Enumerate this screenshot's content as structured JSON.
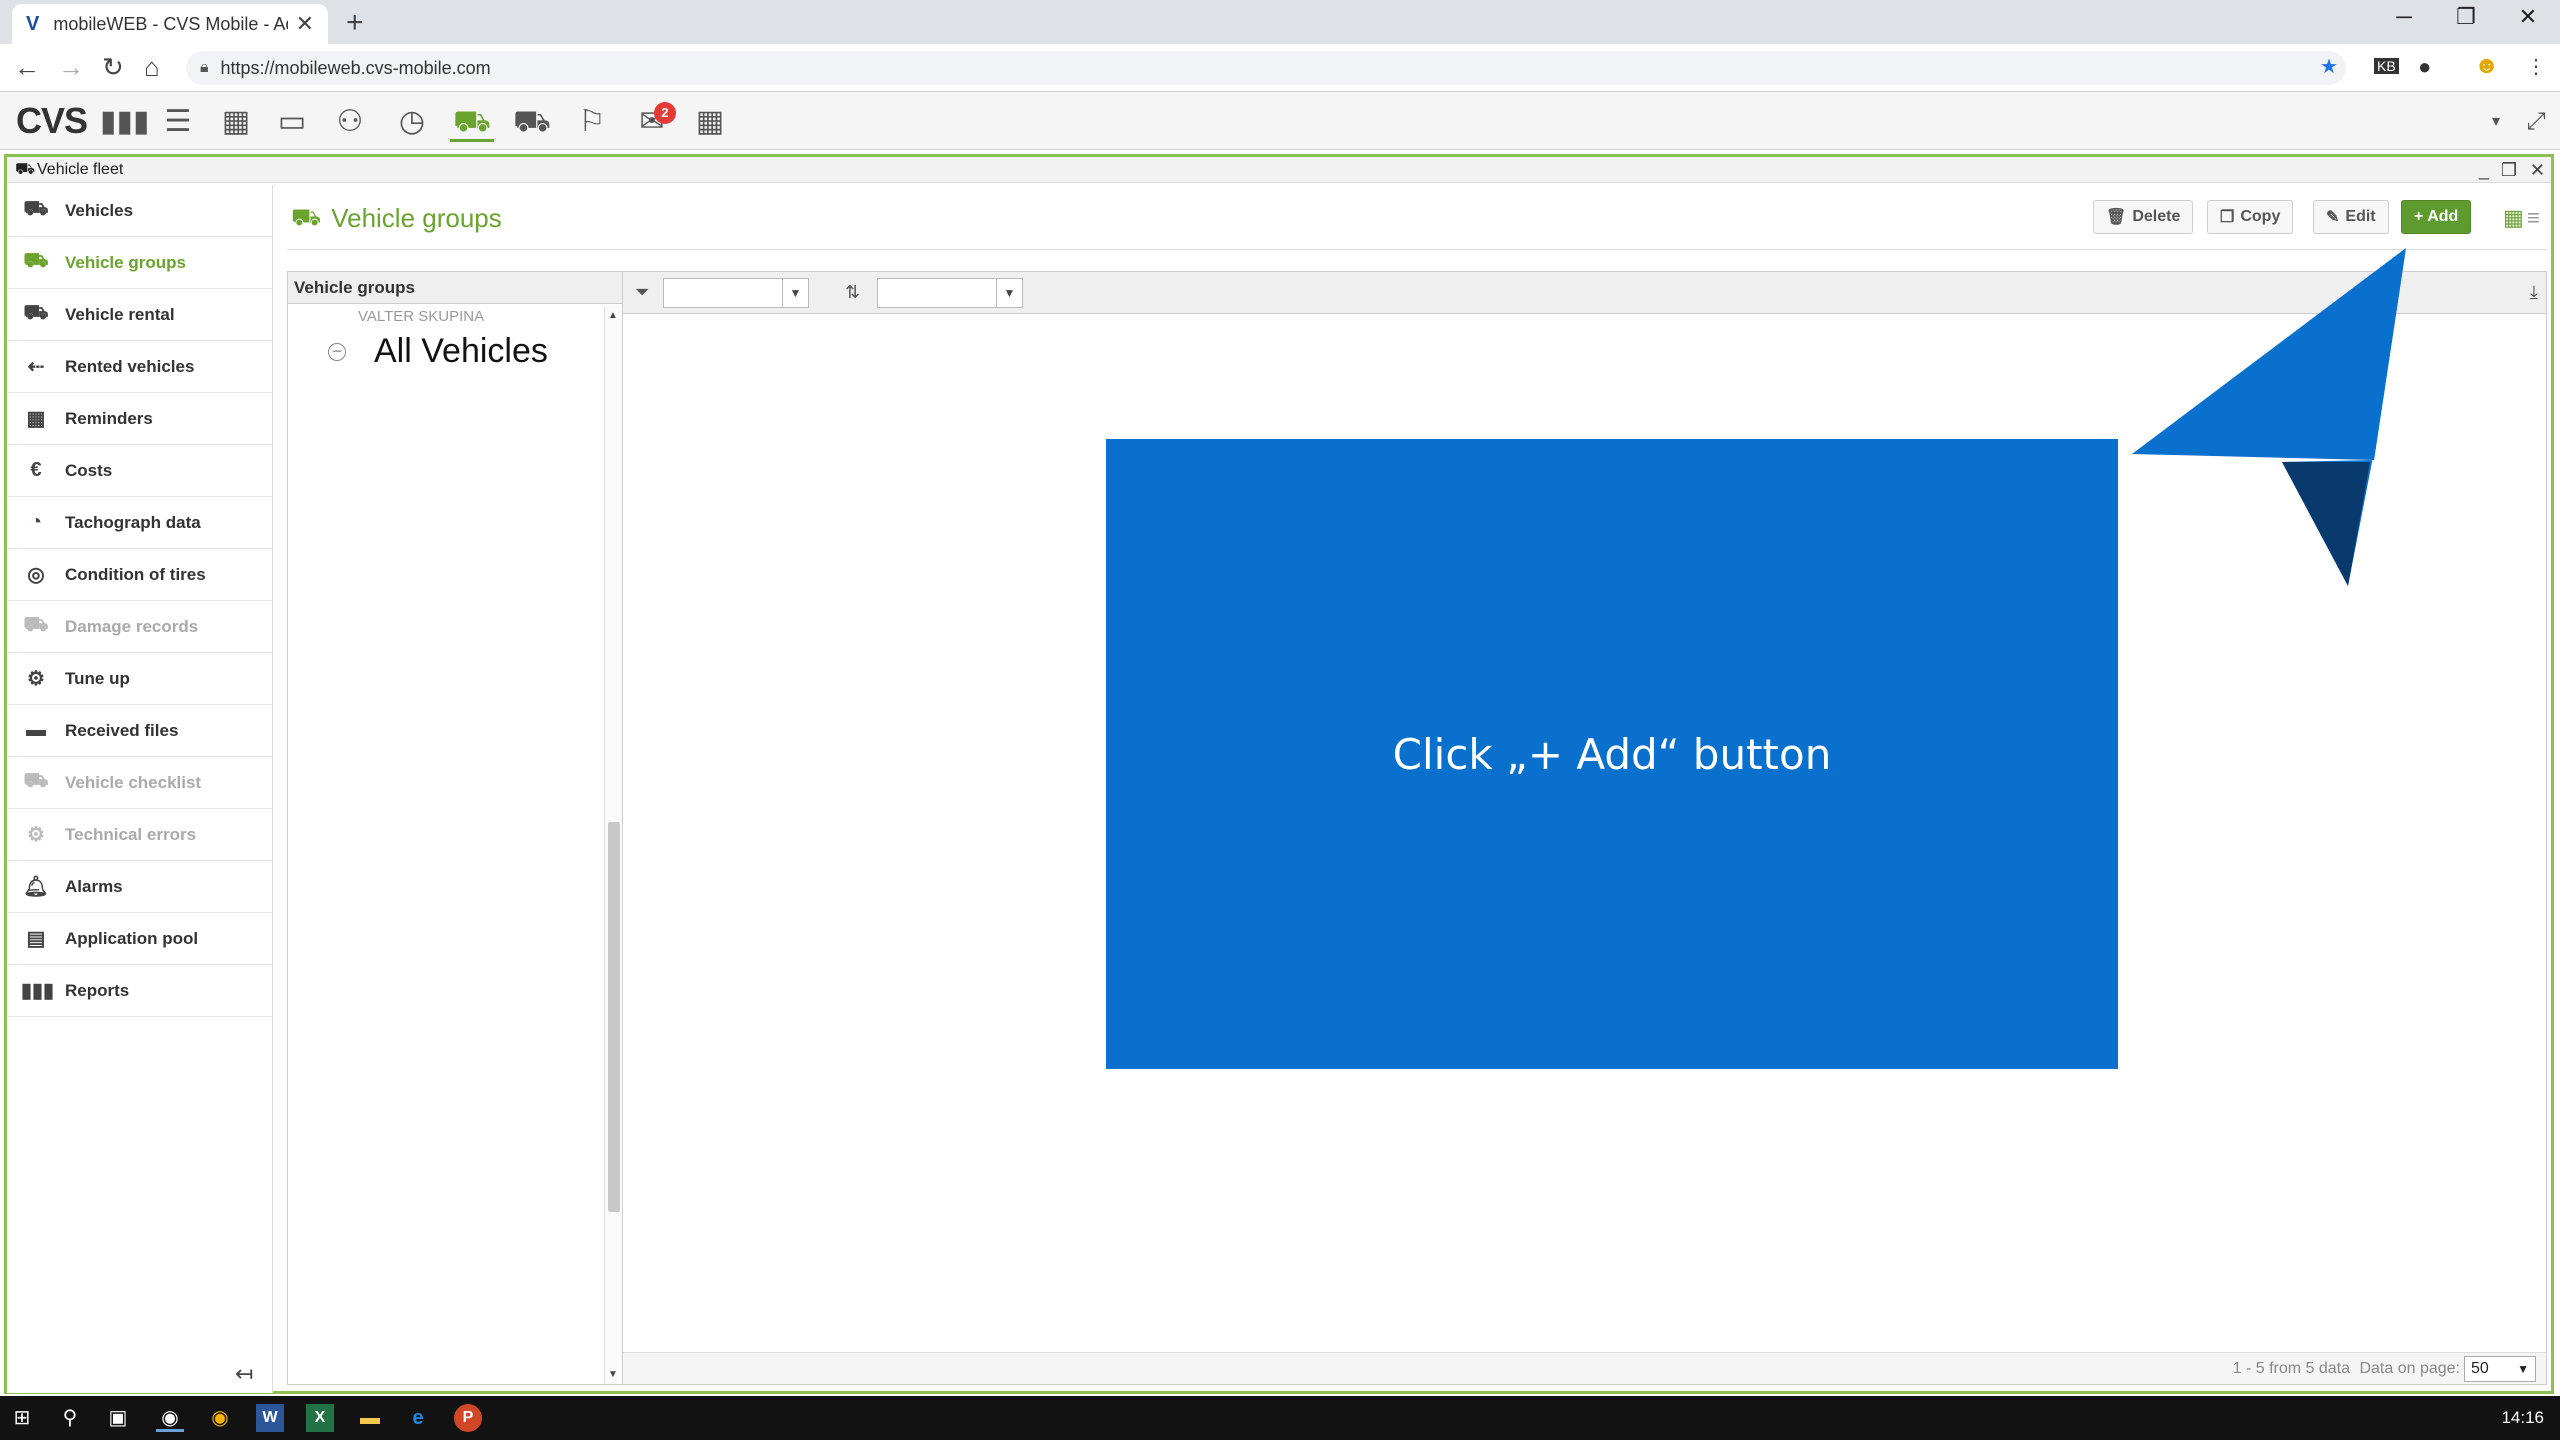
{
  "browser": {
    "tab_title": "mobileWEB - CVS Mobile - Adva",
    "url": "https://mobileweb.cvs-mobile.com",
    "new_tab": "+",
    "tab_close": "✕"
  },
  "app": {
    "logo": "CVS",
    "notification_count": "2"
  },
  "module": {
    "title": "Vehicle fleet"
  },
  "sidebar": {
    "items": [
      {
        "label": "Vehicles",
        "icon": "vehicles-icon"
      },
      {
        "label": "Vehicle groups",
        "icon": "vehicle-groups-icon"
      },
      {
        "label": "Vehicle rental",
        "icon": "vehicle-rental-icon"
      },
      {
        "label": "Rented vehicles",
        "icon": "rented-vehicles-icon"
      },
      {
        "label": "Reminders",
        "icon": "calendar-icon"
      },
      {
        "label": "Costs",
        "icon": "euro-icon"
      },
      {
        "label": "Tachograph data",
        "icon": "gauge-icon"
      },
      {
        "label": "Condition of tires",
        "icon": "tire-icon"
      },
      {
        "label": "Damage records",
        "icon": "damage-icon"
      },
      {
        "label": "Tune up",
        "icon": "tune-up-icon"
      },
      {
        "label": "Received files",
        "icon": "folder-icon"
      },
      {
        "label": "Vehicle checklist",
        "icon": "checklist-icon"
      },
      {
        "label": "Technical errors",
        "icon": "engine-icon"
      },
      {
        "label": "Alarms",
        "icon": "bell-icon"
      },
      {
        "label": "Application pool",
        "icon": "app-pool-icon"
      },
      {
        "label": "Reports",
        "icon": "reports-icon"
      }
    ]
  },
  "content": {
    "heading": "Vehicle groups",
    "buttons": {
      "delete": "Delete",
      "copy": "Copy",
      "edit": "Edit",
      "add": "+ Add"
    }
  },
  "tree": {
    "header": "Vehicle groups",
    "partial_item": "VALTER SKUPINA",
    "root_item": "All Vehicles"
  },
  "grid": {
    "pager_info": "1 - 5 from 5 data",
    "per_page_label": "Data on page:",
    "per_page_value": "50"
  },
  "overlay": {
    "instruction": "Click „+ Add“ button",
    "box_color": "#0a70ce",
    "arrow_color": "#0a70ce",
    "arrow_shadow_color": "#083a6e"
  },
  "taskbar": {
    "clock": "14:16"
  },
  "colors": {
    "accent": "#6aa32e",
    "add_button": "#5d9b2f",
    "badge": "#e53935"
  }
}
